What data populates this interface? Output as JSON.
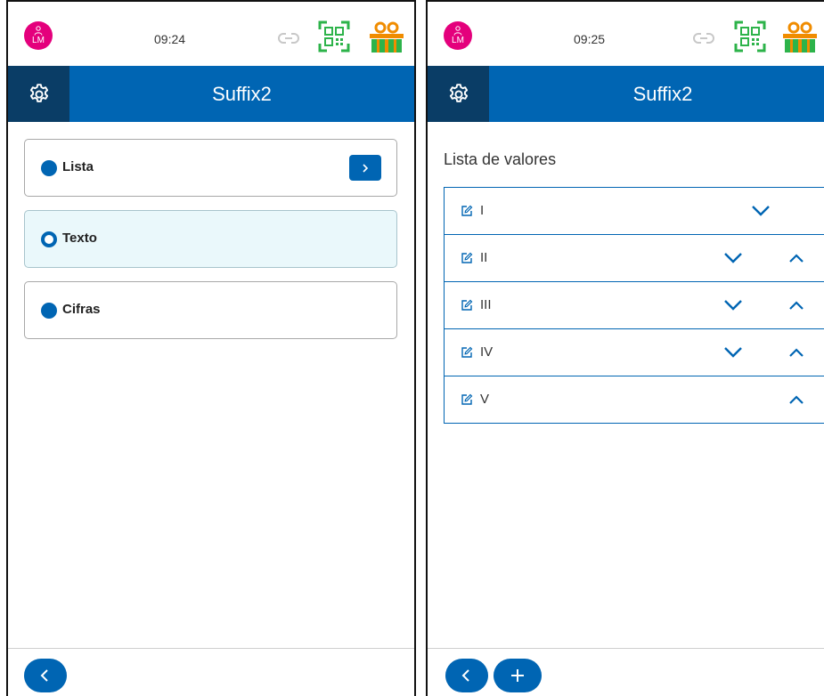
{
  "screens": [
    {
      "status": {
        "avatar_initials": "LM",
        "time": "09:24"
      },
      "title": "Suffix2",
      "options": [
        {
          "label": "Lista",
          "selected": false,
          "has_arrow": true
        },
        {
          "label": "Texto",
          "selected": true,
          "has_arrow": false
        },
        {
          "label": "Cifras",
          "selected": false,
          "has_arrow": false
        }
      ]
    },
    {
      "status": {
        "avatar_initials": "LM",
        "time": "09:25"
      },
      "title": "Suffix2",
      "list_heading": "Lista de valores",
      "values": [
        {
          "label": "I",
          "down": true,
          "up": false
        },
        {
          "label": "II",
          "down": true,
          "up": true
        },
        {
          "label": "III",
          "down": true,
          "up": true
        },
        {
          "label": "IV",
          "down": true,
          "up": true
        },
        {
          "label": "V",
          "down": false,
          "up": true
        }
      ]
    }
  ],
  "colors": {
    "primary": "#0065b3",
    "settings_dark": "#0a3d66",
    "avatar": "#e4007c",
    "qr_green": "#2db34a",
    "gift_orange": "#f08c00",
    "selected_bg": "#eaf8fb"
  },
  "icons": {
    "avatar": "user-avatar-icon",
    "link": "link-icon",
    "qr": "qr-code-icon",
    "gift": "gift-icon",
    "settings": "gear-icon",
    "back": "chevron-left-icon",
    "add": "plus-icon",
    "edit": "edit-icon",
    "down": "chevron-down-icon",
    "up": "chevron-up-icon"
  }
}
